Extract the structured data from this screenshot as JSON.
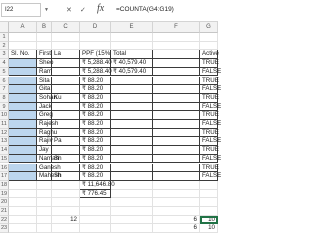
{
  "formula_bar": {
    "name_box": "I22",
    "fx_label": "fx",
    "formula": "=COUNTA(G4:G19)",
    "cancel_glyph": "✕",
    "enter_glyph": "✓"
  },
  "columns": [
    "A",
    "B",
    "C",
    "D",
    "E",
    "F",
    "G"
  ],
  "headers": {
    "sno": "Sl. No.",
    "name": "First Name",
    "last": "La",
    "ppf": "PPF (15%)",
    "total": "Total",
    "active": "Active"
  },
  "rows": [
    {
      "row": "4",
      "name": "Sheo",
      "last": "",
      "ppf": "₹ 5,288.40",
      "total": "₹ 40,579.40",
      "active": "TRUE"
    },
    {
      "row": "5",
      "name": "Ram",
      "last": "",
      "ppf": "₹ 5,288.40",
      "total": "₹ 40,579.40",
      "active": "FALSE"
    },
    {
      "row": "6",
      "name": "Sita",
      "last": "",
      "ppf": "₹ 88.20",
      "total": "",
      "active": "TRUE"
    },
    {
      "row": "7",
      "name": "Gita",
      "last": "",
      "ppf": "₹ 88.20",
      "total": "",
      "active": "FALSE"
    },
    {
      "row": "8",
      "name": "Sohan",
      "last": "Ku",
      "ppf": "₹ 88.20",
      "total": "",
      "active": "TRUE"
    },
    {
      "row": "9",
      "name": "Jack",
      "last": "",
      "ppf": "₹ 88.20",
      "total": "",
      "active": "FALSE"
    },
    {
      "row": "10",
      "name": "Greg",
      "last": "",
      "ppf": "₹ 88.20",
      "total": "",
      "active": "TRUE"
    },
    {
      "row": "11",
      "name": "Rajesh",
      "last": "",
      "ppf": "₹ 88.20",
      "total": "",
      "active": "FALSE"
    },
    {
      "row": "12",
      "name": "Raghu",
      "last": "",
      "ppf": "₹ 88.20",
      "total": "",
      "active": "TRUE"
    },
    {
      "row": "13",
      "name": "Rajiv",
      "last": "Pa",
      "ppf": "₹ 88.20",
      "total": "",
      "active": "FALSE"
    },
    {
      "row": "14",
      "name": "Jay",
      "last": "",
      "ppf": "₹ 88.20",
      "total": "",
      "active": "TRUE"
    },
    {
      "row": "15",
      "name": "Namah",
      "last": "Sh",
      "ppf": "₹ 88.20",
      "total": "",
      "active": "FALSE"
    },
    {
      "row": "16",
      "name": "Ganesh",
      "last": "",
      "ppf": "₹ 88.20",
      "total": "",
      "active": "TRUE"
    },
    {
      "row": "17",
      "name": "Mahesh",
      "last": "Sh",
      "ppf": "₹ 88.20",
      "total": "",
      "active": "FALSE"
    }
  ],
  "extra_rows": [
    {
      "row": "18",
      "ppf": "₹ 11,646.80"
    },
    {
      "row": "19",
      "ppf": "₹ 776.45"
    },
    {
      "row": "20",
      "ppf": ""
    },
    {
      "row": "21",
      "ppf": ""
    }
  ],
  "row22": {
    "row": "22",
    "c_val": "12",
    "g_val": "6",
    "h_val": "10"
  },
  "row23": {
    "row": "23",
    "g_val": "6",
    "h_val": "10"
  },
  "top_rows": [
    "1",
    "2",
    "3"
  ],
  "colors": {
    "selection": "#bcd6ee",
    "active_border": "#217346"
  }
}
